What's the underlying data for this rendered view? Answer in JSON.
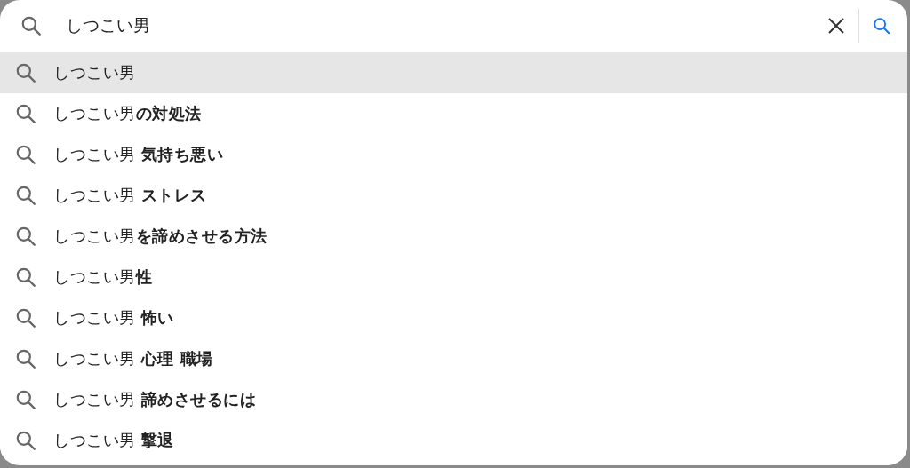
{
  "search": {
    "value": "しつこい男"
  },
  "suggestions": [
    {
      "text": "しつこい男",
      "selected": true
    },
    {
      "text": "しつこい男**の対処法**",
      "selected": false
    },
    {
      "text": "しつこい男 **気持ち悪い**",
      "selected": false
    },
    {
      "text": "しつこい男 **ストレス**",
      "selected": false
    },
    {
      "text": "しつこい男**を諦めさせる方法**",
      "selected": false
    },
    {
      "text": "しつこい男**性**",
      "selected": false
    },
    {
      "text": "しつこい男 **怖い**",
      "selected": false
    },
    {
      "text": "しつこい男 **心理 職場**",
      "selected": false
    },
    {
      "text": "しつこい男 **諦めさせるには**",
      "selected": false
    },
    {
      "text": "しつこい男 **撃退**",
      "selected": false
    }
  ]
}
